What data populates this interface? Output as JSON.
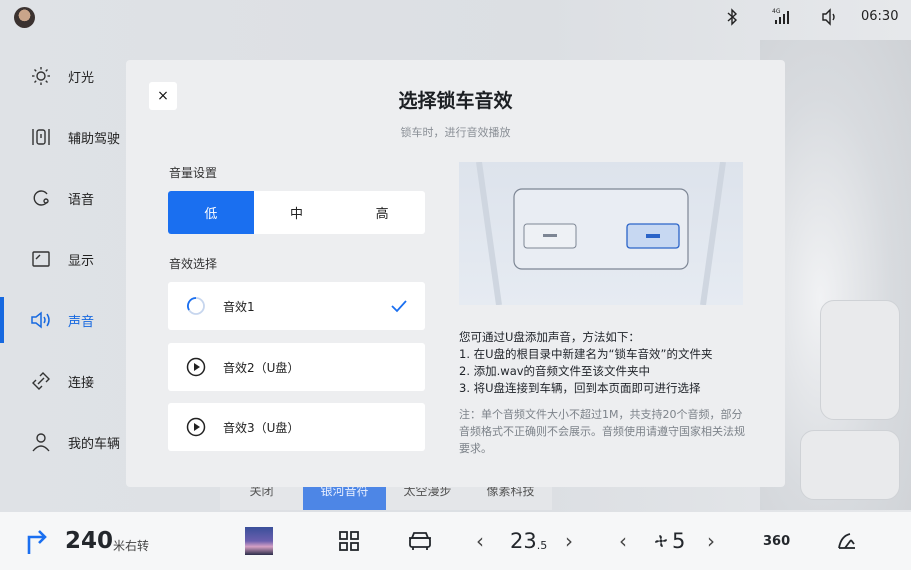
{
  "status": {
    "time": "06:30",
    "signal": "4G"
  },
  "sidebar": {
    "items": [
      {
        "label": "灯光",
        "icon": "sun-icon"
      },
      {
        "label": "辅助驾驶",
        "icon": "lane-assist-icon"
      },
      {
        "label": "语音",
        "icon": "voice-icon"
      },
      {
        "label": "显示",
        "icon": "display-icon"
      },
      {
        "label": "声音",
        "icon": "speaker-icon",
        "active": true
      },
      {
        "label": "连接",
        "icon": "link-icon"
      },
      {
        "label": "我的车辆",
        "icon": "person-icon"
      }
    ]
  },
  "behind_bar": {
    "items": [
      "关闭",
      "银河音符",
      "太空漫步",
      "像素科技"
    ]
  },
  "dialog": {
    "close": "×",
    "title": "选择锁车音效",
    "subtitle": "锁车时，进行音效播放",
    "volume_label": "音量设置",
    "volume_options": [
      "低",
      "中",
      "高"
    ],
    "volume_selected": "低",
    "sound_label": "音效选择",
    "sounds": [
      {
        "label": "音效1",
        "icon": "loading-icon",
        "selected": true
      },
      {
        "label": "音效2（U盘）",
        "icon": "play-icon"
      },
      {
        "label": "音效3（U盘）",
        "icon": "play-icon"
      }
    ],
    "info": {
      "heading": "您可通过U盘添加声音，方法如下：",
      "steps": [
        "1. 在U盘的根目录中新建名为“锁车音效”的文件夹",
        "2. 添加.wav的音频文件至该文件夹中",
        "3. 将U盘连接到车辆，回到本页面即可进行选择"
      ]
    },
    "note": "注：单个音频文件大小不超过1M，共支持20个音频，部分音频格式不正确则不会展示。音频使用请遵守国家相关法规要求。"
  },
  "dock": {
    "distance": "240",
    "distance_unit": "米右转",
    "temperature": "23",
    "temperature_decimal": ".5",
    "fan": "5",
    "view_360": "360"
  },
  "colors": {
    "accent": "#1a6ff0",
    "dialog_bg": "#edeef0"
  }
}
